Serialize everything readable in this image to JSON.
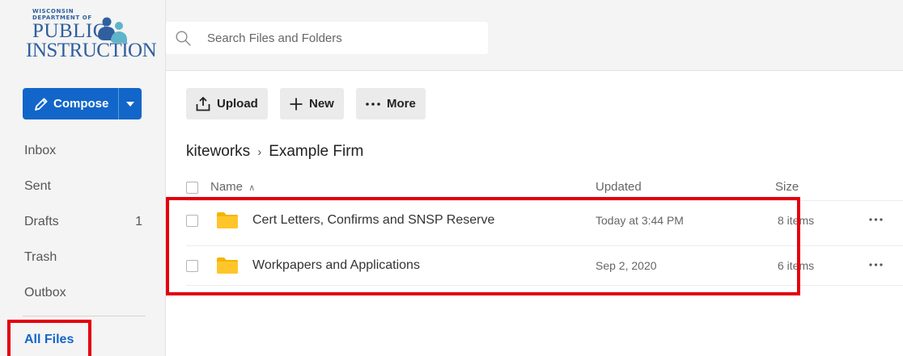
{
  "logo": {
    "line_small_1": "WISCONSIN",
    "line_small_2": "DEPARTMENT OF",
    "line_1": "PUBLIC",
    "line_2": "INSTRUCTION",
    "colors": {
      "text": "#2f5f9e",
      "figure_blue": "#2f5f9e",
      "figure_teal": "#5fb4c9"
    }
  },
  "compose": {
    "label": "Compose",
    "icon": "pencil-icon",
    "caret_icon": "caret-down-icon",
    "color": "#1266c9"
  },
  "nav": {
    "items": [
      {
        "label": "Inbox",
        "count": ""
      },
      {
        "label": "Sent",
        "count": ""
      },
      {
        "label": "Drafts",
        "count": "1"
      },
      {
        "label": "Trash",
        "count": ""
      },
      {
        "label": "Outbox",
        "count": ""
      }
    ],
    "active": {
      "label": "All Files"
    },
    "active_color": "#1266c9"
  },
  "search": {
    "placeholder": "Search Files and Folders",
    "value": "",
    "icon": "search-icon"
  },
  "toolbar": {
    "upload_label": "Upload",
    "new_label": "New",
    "more_label": "More",
    "upload_icon": "upload-icon",
    "new_icon": "plus-icon",
    "more_icon": "ellipsis-icon"
  },
  "breadcrumb": {
    "root": "kiteworks",
    "current": "Example Firm",
    "separator": "›"
  },
  "table": {
    "columns": {
      "name": "Name",
      "updated": "Updated",
      "size": "Size"
    },
    "sort_indicator": "∧",
    "rows": [
      {
        "name": "Cert Letters, Confirms and SNSP Reserve",
        "updated": "Today at 3:44 PM",
        "size": "8 items",
        "icon": "folder-icon",
        "actions_icon": "ellipsis-icon"
      },
      {
        "name": "Workpapers and Applications",
        "updated": "Sep 2, 2020",
        "size": "6 items",
        "icon": "folder-icon",
        "actions_icon": "ellipsis-icon"
      }
    ],
    "folder_color": "#ffc62b"
  },
  "callout_color": "#e3000f"
}
